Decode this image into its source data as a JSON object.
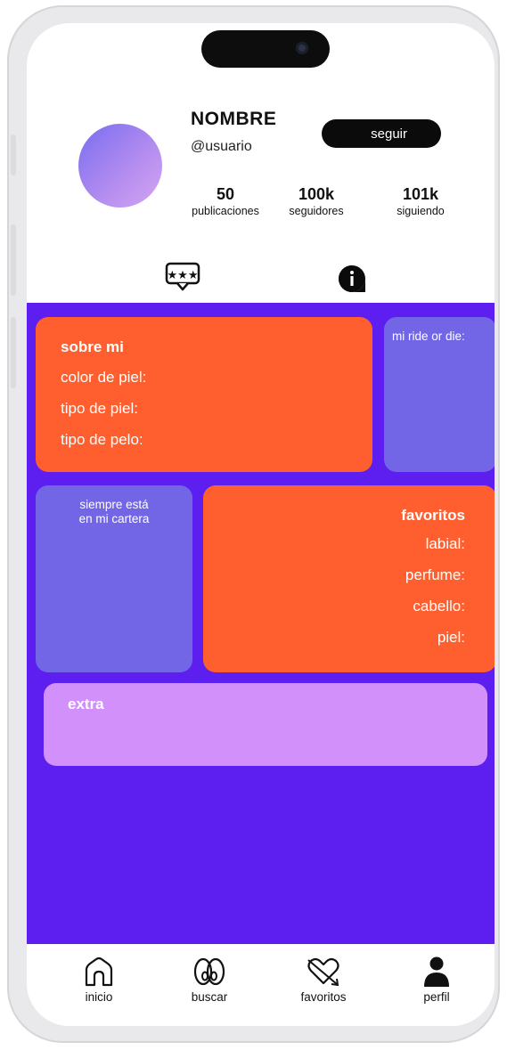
{
  "profile": {
    "name": "NOMBRE",
    "handle": "@usuario",
    "follow_label": "seguir",
    "avatar_gradient": [
      "#7a6cf0",
      "#d7a4f2"
    ]
  },
  "stats": [
    {
      "value": "50",
      "label": "publicaciones"
    },
    {
      "value": "100k",
      "label": "seguidores"
    },
    {
      "value": "101k",
      "label": "siguiendo"
    }
  ],
  "tabs": [
    {
      "icon": "rating-message-icon"
    },
    {
      "icon": "info-icon"
    }
  ],
  "cards": {
    "about": {
      "title": "sobre mi",
      "lines": [
        "color de piel:",
        "tipo de piel:",
        "tipo de pelo:"
      ]
    },
    "ride_or_die": {
      "title": "mi ride or die:"
    },
    "purse": {
      "title_line1": "siempre está",
      "title_line2": "en mi cartera"
    },
    "favorites": {
      "title": "favoritos",
      "lines": [
        "labial:",
        "perfume:",
        "cabello:",
        "piel:"
      ]
    },
    "extra": {
      "title": "extra"
    }
  },
  "nav": [
    {
      "label": "inicio",
      "icon": "home-icon"
    },
    {
      "label": "buscar",
      "icon": "eyes-icon"
    },
    {
      "label": "favoritos",
      "icon": "heart-arrow-icon"
    },
    {
      "label": "perfil",
      "icon": "person-icon"
    }
  ],
  "colors": {
    "background_purple": "#5c1ff0",
    "card_orange": "#ff5f2e",
    "card_lavender": "#7266e6",
    "card_pink": "#d291fa",
    "button_black": "#0b0b0b"
  }
}
